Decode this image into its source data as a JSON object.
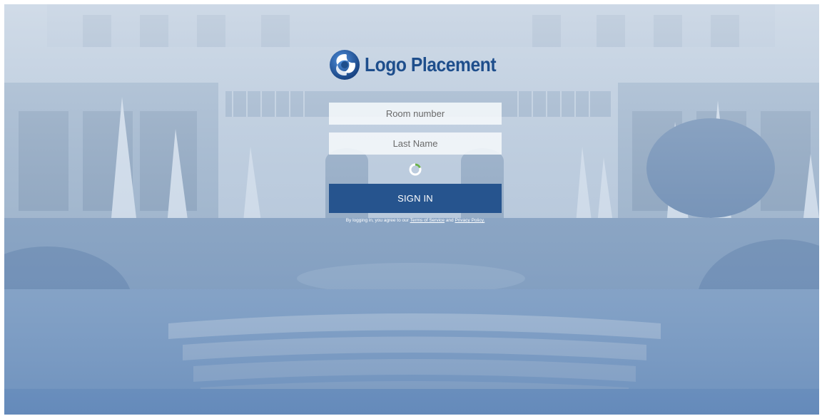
{
  "logo": {
    "text": "Logo Placement",
    "icon": "swirl-logo-icon",
    "color": "#1e4e8c"
  },
  "form": {
    "room_placeholder": "Room number",
    "lastname_placeholder": "Last Name",
    "signin_label": "SIGN IN",
    "signin_color": "#26548e"
  },
  "legal": {
    "prefix": "By logging in, you agree to our",
    "terms_link": "Terms of Service",
    "connector": "and",
    "privacy_link": "Privacy Policy."
  },
  "spinner": {
    "icon": "loading-spinner-icon",
    "accent_color": "#6ab04c"
  }
}
